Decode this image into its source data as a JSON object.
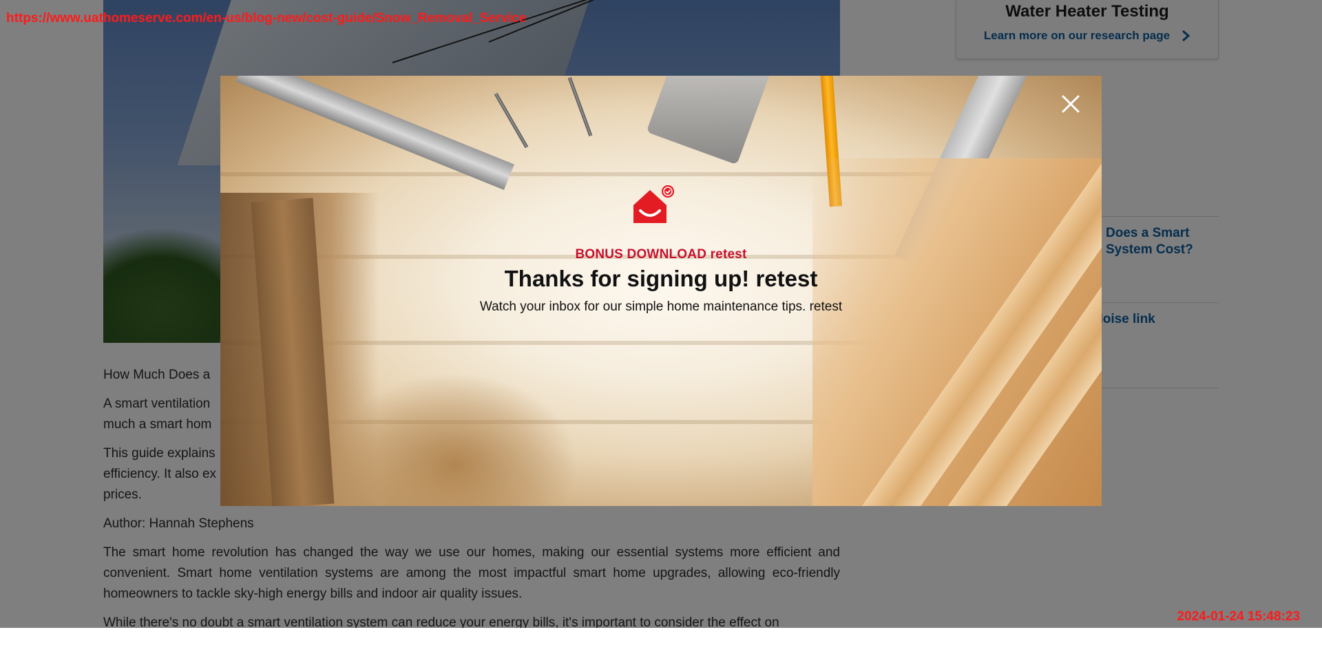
{
  "recording": {
    "url": "https://www.uathomeserve.com/en-us/blog-new/cost-guide/Snow_Removal_Service",
    "timestamp": "2024-01-24 15:48:23"
  },
  "article": {
    "paragraphs": [
      "How Much Does a",
      "A smart ventilation",
      "much a smart hom",
      "This guide explains",
      "efficiency. It also ex",
      "prices.",
      "Author: Hannah Stephens",
      "The smart home revolution has changed the way we use our homes, making our essential systems more efficient and convenient. Smart home ventilation systems are among the most impactful smart home upgrades, allowing eco-friendly homeowners to tackle sky-high energy bills and indoor air quality issues.",
      "While there's no doubt a smart ventilation system can reduce your energy bills, it's important to consider the effect on"
    ]
  },
  "sidebar": {
    "promo_title": "Water Heater Testing",
    "promo_link": "Learn more on our research page",
    "related": [
      "Does a Smart System Cost?",
      "Noise link"
    ]
  },
  "modal": {
    "kicker": "BONUS DOWNLOAD retest",
    "title": "Thanks for signing up! retest",
    "message": "Watch your inbox for our simple home maintenance tips. retest",
    "close_icon": "close-icon",
    "brand_icon": "house-check-icon",
    "brand_color": "#e31b23"
  }
}
